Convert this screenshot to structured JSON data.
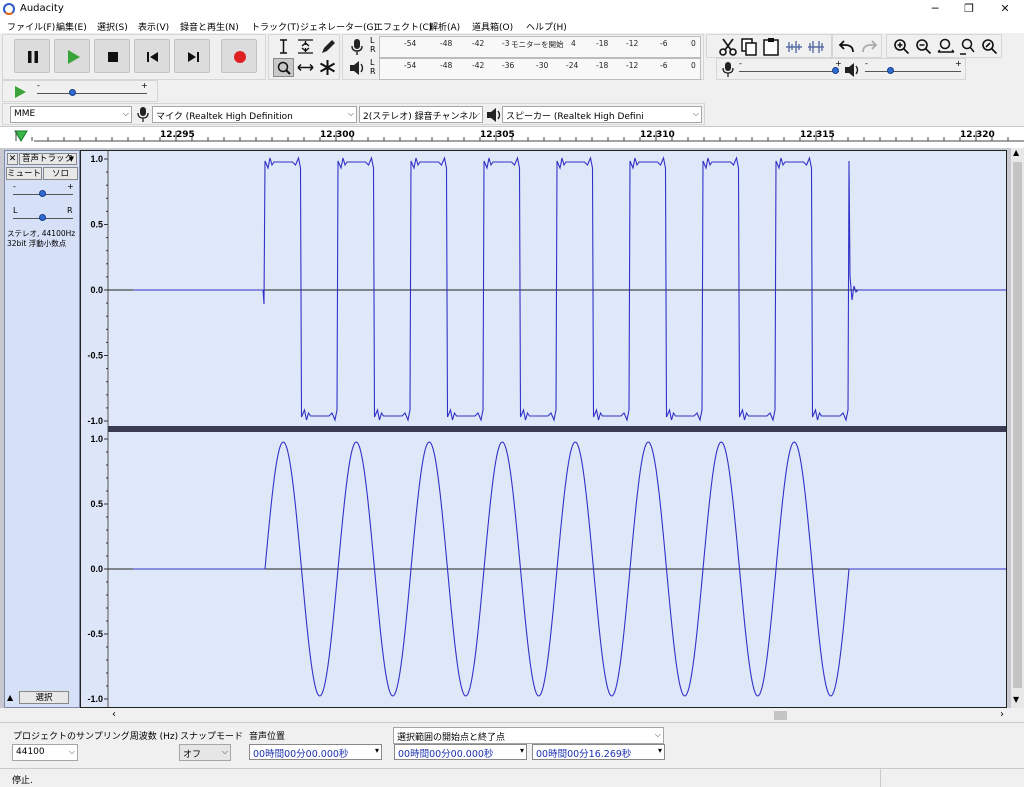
{
  "window": {
    "title": "Audacity"
  },
  "menu": [
    "ファイル(F)",
    "編集(E)",
    "選択(S)",
    "表示(V)",
    "録音と再生(N)",
    "トラック(T)",
    "ジェネレーター(G)",
    "エフェクト(C)",
    "解析(A)",
    "道具箱(O)",
    "ヘルプ(H)"
  ],
  "transport": {
    "buttons": [
      "pause",
      "play",
      "stop",
      "skip-to-start",
      "skip-to-end",
      "record"
    ],
    "colors": {
      "play": "#3aa43a",
      "record": "#e02020"
    }
  },
  "meters": {
    "record_ticks": [
      "-54",
      "-48",
      "-42",
      "-3",
      "モニターを開始",
      "4",
      "-18",
      "-12",
      "-6",
      "0"
    ],
    "playback_ticks": [
      "-54",
      "-48",
      "-42",
      "-36",
      "-30",
      "-24",
      "-18",
      "-12",
      "-6",
      "0"
    ],
    "channel_l": "L",
    "channel_r": "R"
  },
  "mixer": {
    "record_minus": "-",
    "record_plus": "+",
    "play_minus": "-",
    "play_plus": "+"
  },
  "play_at_speed": {
    "minus": "-",
    "plus": "+"
  },
  "devices": {
    "host": "MME",
    "recording_device": "マイク (Realtek High Definition",
    "channels": "2(ステレオ) 録音チャンネル",
    "playback_device": "スピーカー (Realtek High Defini"
  },
  "ruler": {
    "labels": [
      "12.295",
      "12.300",
      "12.305",
      "12.310",
      "12.315",
      "12.320"
    ]
  },
  "track": {
    "name": "音声トラック",
    "close": "✕",
    "mute": "ミュート",
    "solo": "ソロ",
    "gain_minus": "-",
    "gain_plus": "+",
    "pan_left": "L",
    "pan_right": "R",
    "info_line1": "ステレオ, 44100Hz",
    "info_line2": "32bit 浮動小数点",
    "select": "選択",
    "scale_labels": [
      "1.0",
      "0.5",
      "0.0",
      "-0.5",
      "-1.0"
    ],
    "wave_color": "#3232c8"
  },
  "selection_toolbar": {
    "rate_label": "プロジェクトのサンプリング周波数 (Hz)",
    "rate_value": "44100",
    "snap_label": "スナップモード",
    "snap_value": "オフ",
    "position_label": "音声位置",
    "position_value": "00時間00分00.000秒",
    "range_label": "選択範囲の開始点と終了点",
    "range_start": "00時間00分00.000秒",
    "range_end": "00時間00分16.269秒"
  },
  "status": {
    "text": "停止."
  }
}
